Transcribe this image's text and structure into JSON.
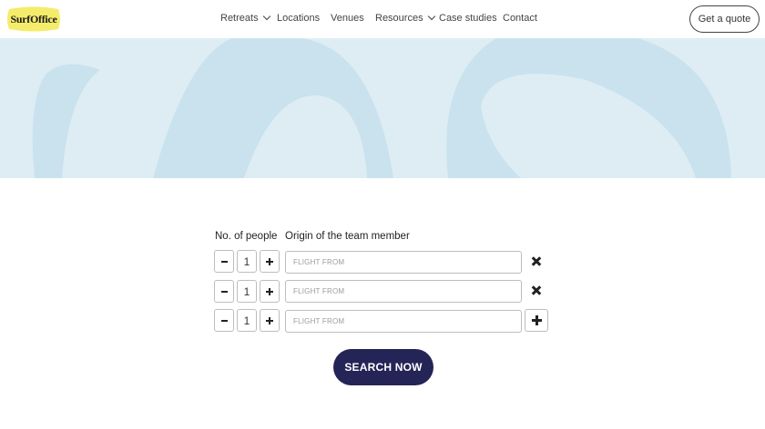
{
  "header": {
    "logo_text": "SurfOffice",
    "nav": [
      {
        "label": "Retreats",
        "has_dropdown": true
      },
      {
        "label": "Locations",
        "has_dropdown": false
      },
      {
        "label": "Venues",
        "has_dropdown": false
      },
      {
        "label": "Resources",
        "has_dropdown": true
      },
      {
        "label": "Case studies",
        "has_dropdown": false
      },
      {
        "label": "Contact",
        "has_dropdown": false
      }
    ],
    "quote_label": "Get a quote"
  },
  "colors": {
    "logo_yellow": "#f5ec6b",
    "hero_bg": "#deedf4",
    "hero_shapes": "#c9e2ee",
    "button_navy": "#242457"
  },
  "form": {
    "people_label": "No. of people",
    "origin_label": "Origin of the team member",
    "rows": [
      {
        "count": "1",
        "placeholder": "FLIGHT FROM",
        "action": "remove"
      },
      {
        "count": "1",
        "placeholder": "FLIGHT FROM",
        "action": "remove"
      },
      {
        "count": "1",
        "placeholder": "FLIGHT FROM",
        "action": "add"
      }
    ],
    "search_label": "SEARCH NOW"
  }
}
